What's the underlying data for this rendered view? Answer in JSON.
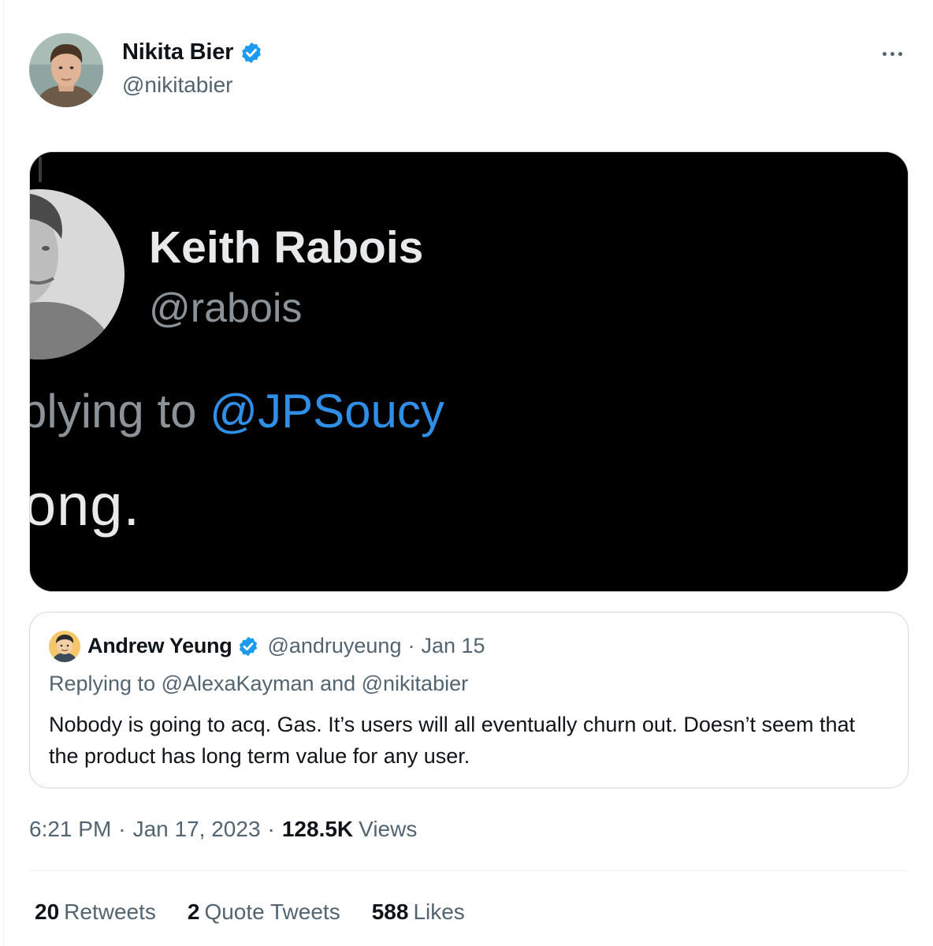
{
  "author": {
    "name": "Nikita Bier",
    "handle": "@nikitabier",
    "verified": true,
    "avatar_icon": "person-avatar"
  },
  "media": {
    "screenshot_name": "Keith Rabois",
    "screenshot_handle": "@rabois",
    "screenshot_replying_prefix": "plying to ",
    "screenshot_replying_mention": "@JPSoucy",
    "screenshot_body": "ong."
  },
  "quote": {
    "name": "Andrew Yeung",
    "handle": "@andruyeung",
    "separator": "·",
    "date": "Jan 15",
    "replying": "Replying to @AlexaKayman and @nikitabier",
    "text": "Nobody is going to acq. Gas. It’s users will all eventually churn out. Doesn’t seem that the product has long term value for any user."
  },
  "meta": {
    "time": "6:21 PM",
    "separator": "·",
    "date": "Jan 17, 2023",
    "views_count": "128.5K",
    "views_label": "Views"
  },
  "stats": {
    "retweets_count": "20",
    "retweets_label": "Retweets",
    "quotes_count": "2",
    "quotes_label": "Quote Tweets",
    "likes_count": "588",
    "likes_label": "Likes"
  },
  "colors": {
    "verified_blue": "#1d9bf0",
    "mention_blue": "#2f8fe6",
    "secondary_text": "#536471"
  }
}
